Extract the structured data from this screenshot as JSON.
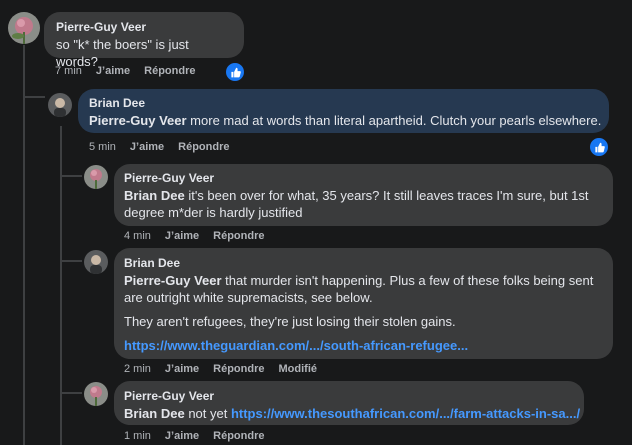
{
  "comments": [
    {
      "author": "Pierre-Guy Veer",
      "text": "so \"k* the boers\" is just words?",
      "time": "7 min",
      "like_label": "J’aime",
      "reply_label": "Répondre"
    },
    {
      "author": "Brian Dee",
      "mention": "Pierre-Guy Veer",
      "text": " more mad at words than literal apartheid. Clutch your pearls elsewhere.",
      "time": "5 min",
      "like_label": "J’aime",
      "reply_label": "Répondre"
    },
    {
      "author": "Pierre-Guy Veer",
      "mention": "Brian Dee",
      "text_line1": " it's been over for what, 35 years? It still leaves traces I'm sure, but 1st",
      "text_line2": "degree m*der is hardly justified",
      "time": "4 min",
      "like_label": "J’aime",
      "reply_label": "Répondre"
    },
    {
      "author": "Brian Dee",
      "mention": "Pierre-Guy Veer",
      "text_line1": " that murder isn't happening. Plus a few of these folks being sent",
      "text_line2": "are outright white supremacists, see below.",
      "paragraph2": "They aren't refugees, they're just losing their stolen gains.",
      "link": "https://www.theguardian.com/.../south-african-refugee...",
      "time": "2 min",
      "like_label": "J’aime",
      "reply_label": "Répondre",
      "edited_label": "Modifié"
    },
    {
      "author": "Pierre-Guy Veer",
      "mention": "Brian Dee",
      "text": " not yet ",
      "link": "https://www.thesouthafrican.com/.../farm-attacks-in-sa.../",
      "time": "1 min",
      "like_label": "J’aime",
      "reply_label": "Répondre"
    }
  ],
  "colors": {
    "background": "#18191a",
    "bubble": "#3a3b3c",
    "highlight_bubble": "#263951",
    "link": "#4599ff",
    "like_badge": "#1877f2"
  },
  "icons": [
    "thumbs-up-icon"
  ]
}
